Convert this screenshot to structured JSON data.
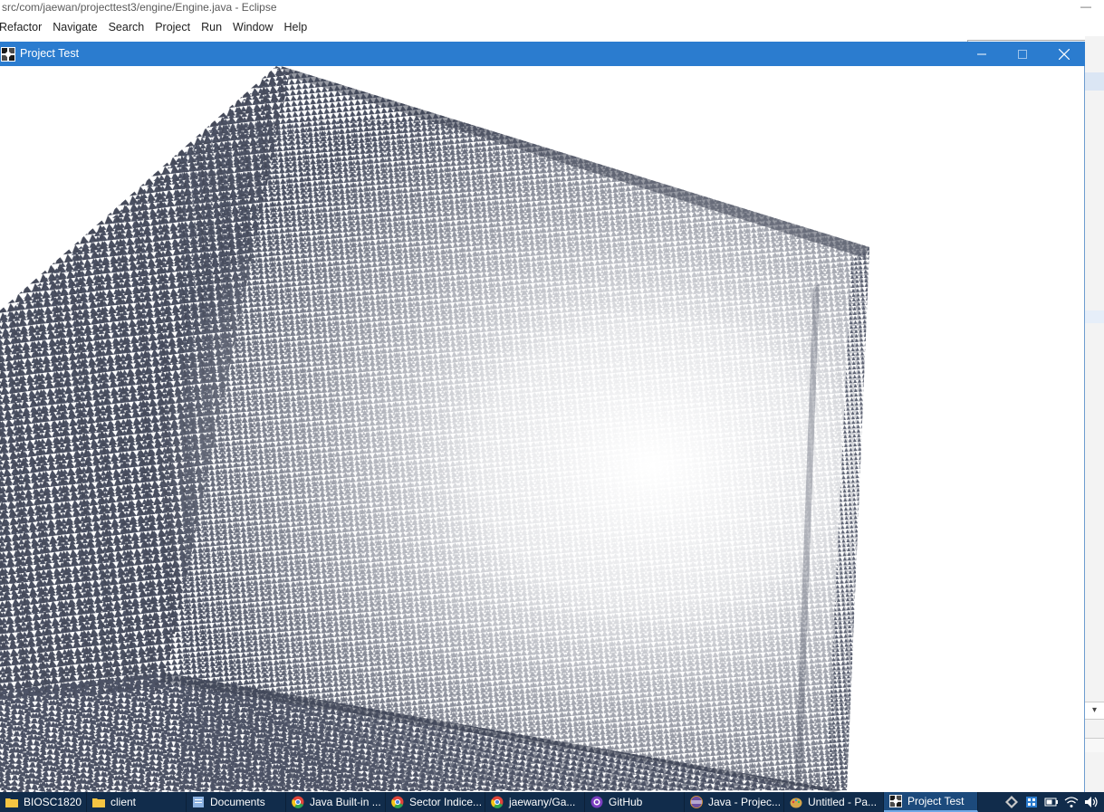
{
  "eclipse": {
    "title": "src/com/jaewan/projecttest3/engine/Engine.java - Eclipse",
    "minimize_glyph": "—",
    "menu": [
      "Refactor",
      "Navigate",
      "Search",
      "Project",
      "Run",
      "Window",
      "Help"
    ]
  },
  "app_window": {
    "title": "Project Test",
    "icon": "java-app-icon",
    "buttons": [
      "minimize",
      "maximize",
      "close"
    ]
  },
  "taskbar": {
    "items": [
      {
        "label": "BIOSC1820",
        "icon": "folder-icon",
        "color": "#f5c542"
      },
      {
        "label": "client",
        "icon": "folder-icon",
        "color": "#f5c542"
      },
      {
        "label": "Documents",
        "icon": "document-icon",
        "color": "#8db3e2"
      },
      {
        "label": "Java Built-in ...",
        "icon": "chrome-icon",
        "color": "#e2443a"
      },
      {
        "label": "Sector Indice...",
        "icon": "chrome-icon",
        "color": "#e2443a"
      },
      {
        "label": "jaewany/Ga...",
        "icon": "chrome-icon",
        "color": "#e2443a"
      },
      {
        "label": "GitHub",
        "icon": "github-desktop-icon",
        "color": "#7b3fbf"
      },
      {
        "label": "Java - Projec...",
        "icon": "eclipse-icon",
        "color": "#6b4fa0"
      },
      {
        "label": "Untitled - Pa...",
        "icon": "paint-icon",
        "color": "#d6a64a"
      },
      {
        "label": "Project Test",
        "icon": "java-app-icon",
        "color": "#ffffff",
        "active": true
      }
    ],
    "tray": [
      "diamond-icon",
      "store-icon",
      "battery-icon",
      "wifi-icon",
      "volume-icon"
    ]
  }
}
